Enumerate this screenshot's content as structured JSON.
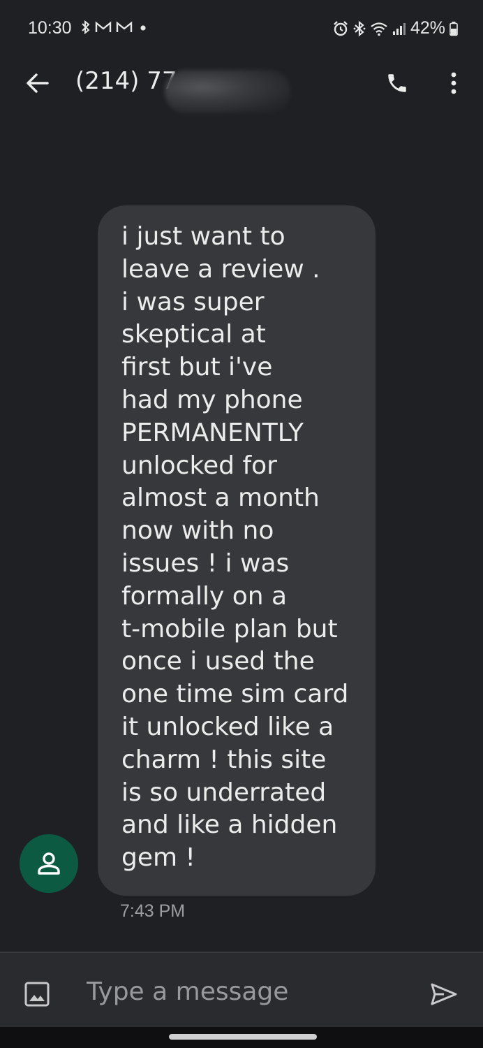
{
  "status_bar": {
    "time": "10:30",
    "battery": "42%",
    "left_icons": [
      "bluetooth-icon",
      "gmail-icon",
      "gmail-icon",
      "notification-dot-icon"
    ],
    "right_icons": [
      "alarm-icon",
      "bluetooth-icon",
      "wifi-icon",
      "signal-icon",
      "battery-icon"
    ]
  },
  "app_bar": {
    "title": "(214) 77",
    "back_icon": "arrow-left-icon",
    "call_icon": "phone-icon",
    "menu_icon": "more-vert-icon"
  },
  "conversation": {
    "message_text": "i just want to\nleave a review .\ni was super\nskeptical at\nfirst but i've\nhad my phone\nPERMANENTLY\nunlocked for\nalmost a month\nnow with no\nissues ! i was\nformally on a\nt-mobile plan but\nonce i used the\none time sim card\nit unlocked like a\ncharm ! this site\nis so underrated\nand like a hidden\ngem !",
    "timestamp": "7:43 PM",
    "avatar_icon": "person-icon"
  },
  "compose": {
    "placeholder": "Type a message",
    "attach_icon": "image-icon",
    "send_icon": "send-icon"
  },
  "colors": {
    "background": "#1f2024",
    "bubble": "#36383c",
    "avatar": "#0d5a43",
    "compose_bar": "#2a2b2f"
  }
}
